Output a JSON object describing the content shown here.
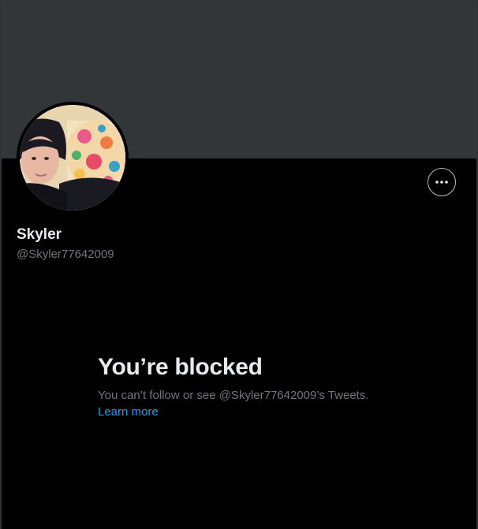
{
  "profile": {
    "display_name": "Skyler",
    "handle": "@Skyler77642009",
    "avatar_icon": "user-photo-avatar",
    "more_icon": "more-horizontal-icon"
  },
  "blocked": {
    "title": "You’re blocked",
    "description": "You can’t follow or see @Skyler77642009’s Tweets.",
    "learn_more": "Learn more"
  },
  "colors": {
    "background": "#000000",
    "banner": "#333639",
    "primary_text": "#e7e9ea",
    "secondary_text": "#71767b",
    "link": "#1d9bf0"
  }
}
